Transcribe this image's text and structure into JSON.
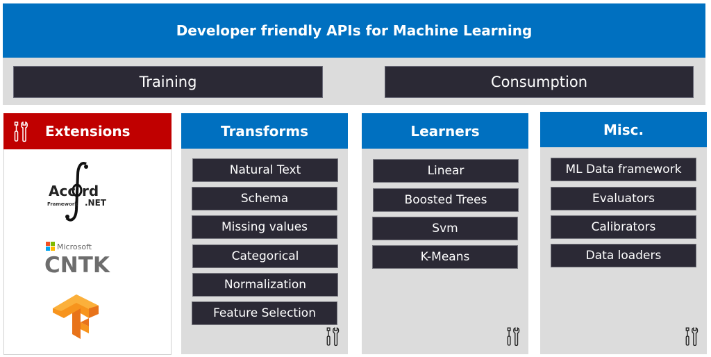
{
  "banner": {
    "title": "Developer friendly APIs for Machine Learning"
  },
  "phases": {
    "training": "Training",
    "consumption": "Consumption"
  },
  "columns": {
    "extensions": {
      "title": "Extensions",
      "icon": "tools-icon",
      "color": "#c00000",
      "logos": [
        {
          "name": "Accord.NET Framework",
          "main": "Acc",
          "main2": "rd",
          "sub": "Framework",
          "suffix": ".NET"
        },
        {
          "name": "Microsoft CNTK",
          "brand": "Microsoft",
          "product": "CNTK"
        },
        {
          "name": "TensorFlow"
        }
      ]
    },
    "transforms": {
      "title": "Transforms",
      "items": [
        "Natural Text",
        "Schema",
        "Missing values",
        "Categorical",
        "Normalization",
        "Feature Selection"
      ],
      "corner_icon": "tools-icon"
    },
    "learners": {
      "title": "Learners",
      "items": [
        "Linear",
        "Boosted Trees",
        "Svm",
        "K-Means"
      ],
      "corner_icon": "tools-icon"
    },
    "misc": {
      "title": "Misc.",
      "items": [
        "ML Data framework",
        "Evaluators",
        "Calibrators",
        "Data loaders"
      ],
      "corner_icon": "tools-icon"
    }
  },
  "colors": {
    "primary_blue": "#0070c0",
    "extensions_red": "#c00000",
    "item_dark": "#2b2935",
    "panel_grey": "#dcdcdc"
  }
}
